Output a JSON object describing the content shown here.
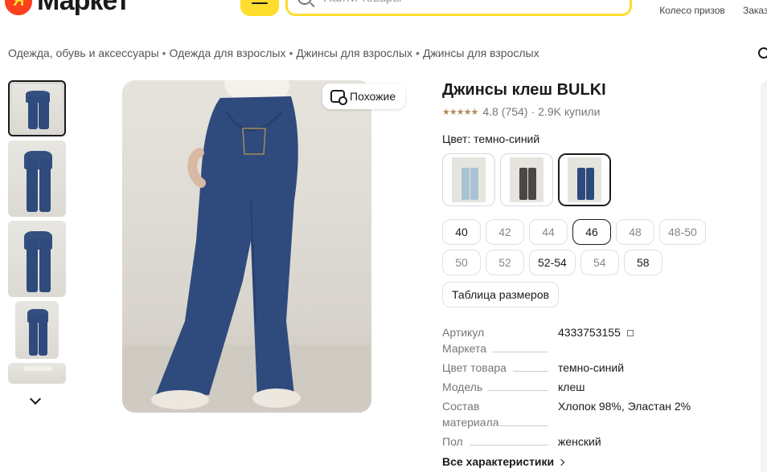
{
  "header": {
    "logo_badge": "Я",
    "logo_text": "Маркет",
    "search_placeholder": "Найти товары",
    "actions": [
      "Колесо призов",
      "Заказы"
    ]
  },
  "breadcrumbs": [
    "Одежда, обувь и аксессуары",
    "Одежда для взрослых",
    "Джинсы для взрослых",
    "Джинсы для взрослых"
  ],
  "breadcrumb_sep": "•",
  "product": {
    "title": "Джинсы клеш BULKI",
    "stars": "★★★★★",
    "rating": "4.8",
    "reviews": "(754)",
    "bought": "2.9K купили",
    "similar_label": "Похожие",
    "color_label": "Цвет: темно-синий",
    "colors": [
      {
        "name": "light-blue",
        "hex": "#a9c3d4"
      },
      {
        "name": "dark-gray",
        "hex": "#4a4744"
      },
      {
        "name": "dark-blue",
        "hex": "#2c4a7e"
      }
    ],
    "sizes": [
      {
        "label": "40",
        "state": "available"
      },
      {
        "label": "42",
        "state": "muted"
      },
      {
        "label": "44",
        "state": "muted"
      },
      {
        "label": "46",
        "state": "selected"
      },
      {
        "label": "48",
        "state": "muted"
      },
      {
        "label": "48-50",
        "state": "muted"
      },
      {
        "label": "50",
        "state": "muted"
      },
      {
        "label": "52",
        "state": "muted"
      },
      {
        "label": "52-54",
        "state": "available"
      },
      {
        "label": "54",
        "state": "muted"
      },
      {
        "label": "58",
        "state": "available"
      }
    ],
    "size_table_label": "Таблица размеров",
    "specs": [
      {
        "key_line1": "Артикул",
        "key_line2": "Маркета",
        "value": "4333753155"
      },
      {
        "key_line1": "Цвет товара",
        "key_line2": "",
        "value": "темно-синий"
      },
      {
        "key_line1": "Модель",
        "key_line2": "",
        "value": "клеш"
      },
      {
        "key_line1": "Состав",
        "key_line2": "материала",
        "value": "Хлопок 98%, Эластан 2%"
      },
      {
        "key_line1": "Пол",
        "key_line2": "",
        "value": "женский"
      }
    ],
    "all_specs_label": "Все характеристики"
  },
  "colors": {
    "accent_yellow": "#ffdd2d",
    "brand_red": "#fc3f1d",
    "denim": "#2f4a7c"
  }
}
